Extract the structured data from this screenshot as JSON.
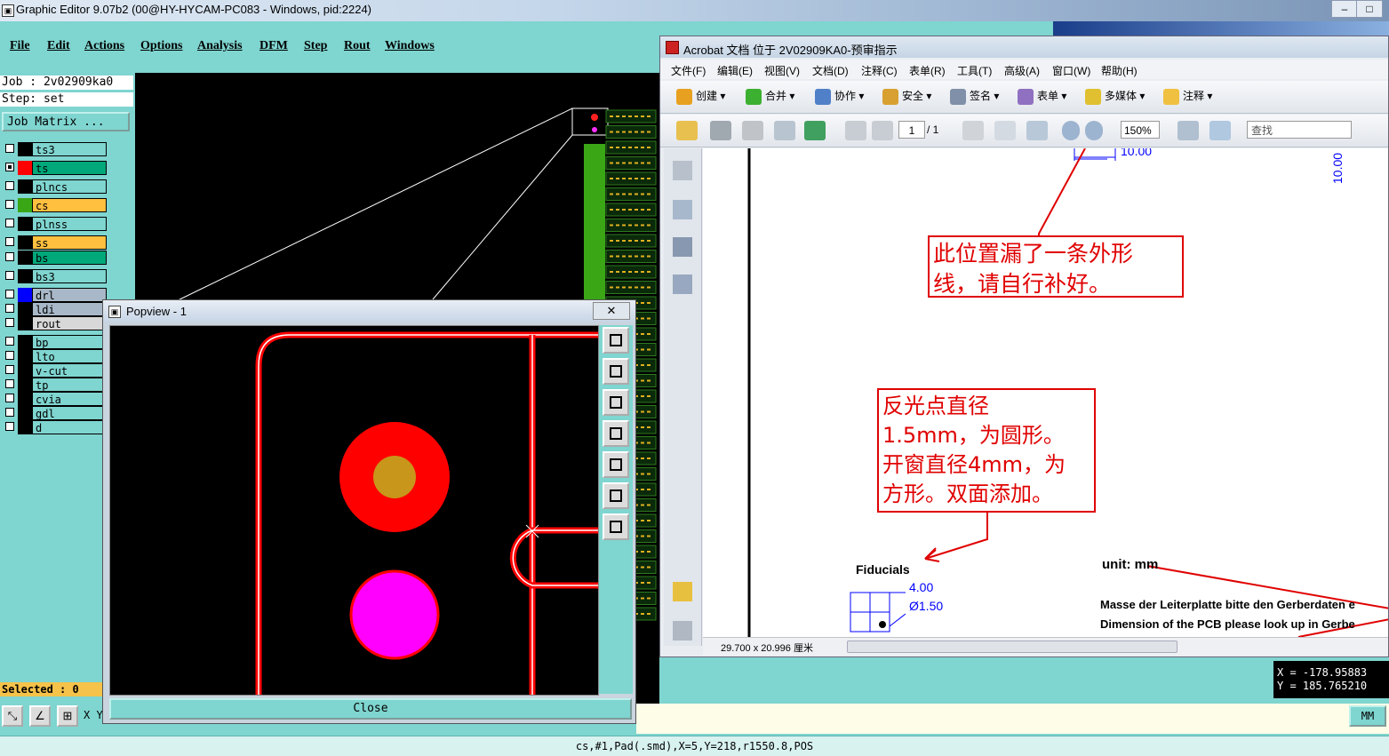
{
  "window": {
    "title": "Graphic Editor 9.07b2 (00@HY-HYCAM-PC083 - Windows, pid:2224)",
    "icon": "app-icon"
  },
  "menubar": [
    "File",
    "Edit",
    "Actions",
    "Options",
    "Analysis",
    "DFM",
    "Step",
    "Rout",
    "Windows"
  ],
  "job": {
    "job_line": "Job : 2v02909ka0",
    "step_line": "Step: set",
    "matrix_button": "Job Matrix ..."
  },
  "layers": [
    {
      "name": "ts3",
      "checked": false,
      "swatch": "#000000",
      "bg": "#7fd5d0"
    },
    {
      "name": "ts",
      "checked": true,
      "swatch": "#ff0000",
      "bg": "#00a87a"
    },
    {
      "name": "plncs",
      "checked": false,
      "swatch": "#000000",
      "bg": "#7fd5d0"
    },
    {
      "name": "cs",
      "checked": false,
      "swatch": "#39a616",
      "bg": "#ffc040"
    },
    {
      "name": "plnss",
      "checked": false,
      "swatch": "#000000",
      "bg": "#7fd5d0"
    },
    {
      "name": "ss",
      "checked": false,
      "swatch": "#000000",
      "bg": "#ffc040"
    },
    {
      "name": "bs",
      "checked": false,
      "swatch": "#000000",
      "bg": "#00a87a"
    },
    {
      "name": "bs3",
      "checked": false,
      "swatch": "#000000",
      "bg": "#7fd5d0"
    },
    {
      "name": "drl",
      "checked": false,
      "swatch": "#0000ff",
      "bg": "#a8b8c8"
    },
    {
      "name": "ldi",
      "checked": false,
      "swatch": "#000000",
      "bg": "#a8b8c8"
    },
    {
      "name": "rout",
      "checked": false,
      "swatch": "#000000",
      "bg": "#d8d8d8"
    },
    {
      "name": "bp",
      "checked": false,
      "swatch": "#000000",
      "bg": "#7fd5d0"
    },
    {
      "name": "lto",
      "checked": false,
      "swatch": "#000000",
      "bg": "#7fd5d0"
    },
    {
      "name": "v-cut",
      "checked": false,
      "swatch": "#000000",
      "bg": "#7fd5d0"
    },
    {
      "name": "tp",
      "checked": false,
      "swatch": "#000000",
      "bg": "#7fd5d0"
    },
    {
      "name": "cvia",
      "checked": false,
      "swatch": "#000000",
      "bg": "#7fd5d0"
    },
    {
      "name": "gdl",
      "checked": false,
      "swatch": "#000000",
      "bg": "#7fd5d0"
    },
    {
      "name": "d",
      "checked": false,
      "swatch": "#000000",
      "bg": "#7fd5d0"
    }
  ],
  "selected_label": "Selected : 0",
  "status_line": "cs,#1,Pad(.smd),X=5,Y=218,r1550.8,POS",
  "coords": {
    "x": "X = -178.95883",
    "y": "Y = 185.765210"
  },
  "units_button": "MM",
  "cursor_label": "X Y",
  "popview": {
    "title": "Popview - 1",
    "close_x": "✕",
    "close_button": "Close"
  },
  "acrobat": {
    "title": "Acrobat 文档 位于 2V02909KA0-预审指示",
    "menu": [
      "文件(F)",
      "编辑(E)",
      "视图(V)",
      "文档(D)",
      "注释(C)",
      "表单(R)",
      "工具(T)",
      "高级(A)",
      "窗口(W)",
      "帮助(H)"
    ],
    "toolbar": [
      "创建",
      "合并",
      "协作",
      "安全",
      "签名",
      "表单",
      "多媒体",
      "注释"
    ],
    "page_current": "1",
    "page_total": "/ 1",
    "zoom": "150%",
    "find_placeholder": "查找",
    "page_size": "29.700 x 20.996 厘米"
  },
  "document": {
    "note1": [
      "此位置漏了一条外形",
      "线，请自行补好。"
    ],
    "note2": [
      "反光点直径",
      "1.5mm，为圆形。",
      "开窗直径4mm，为",
      "方形。双面添加。"
    ],
    "dim_top": "10.00",
    "dim_side": "10.00",
    "fiducials": "Fiducials",
    "dim_400": "4.00",
    "dim_150": "Ø1.50",
    "unit": "unit: mm",
    "line_de": "Masse der Leiterplatte bitte den Gerberdaten e",
    "line_en": "Dimension of the PCB please look up in Gerbe"
  }
}
